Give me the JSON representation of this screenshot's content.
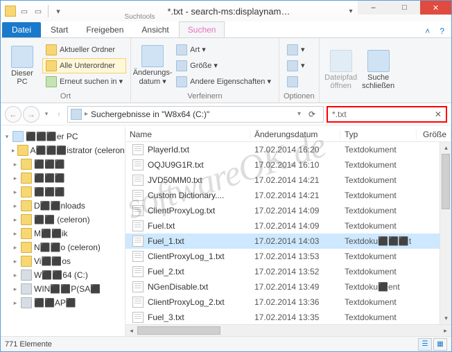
{
  "titlebar": {
    "search_tools_sup": "Suchtools",
    "search_tools_main": "Suchen",
    "title": "*.txt - search-ms:displaynam…"
  },
  "win": {
    "min": "–",
    "max": "□",
    "close": "✕",
    "dropdown": "▾"
  },
  "tabs": {
    "file": "Datei",
    "start": "Start",
    "share": "Freigeben",
    "view": "Ansicht",
    "search": "Suchen",
    "collapse": "˄",
    "help": "?"
  },
  "ribbon": {
    "this_pc": "Dieser PC",
    "current_folder": "Aktueller Ordner",
    "all_subfolders": "Alle Unterordner",
    "search_again": "Erneut suchen in ▾",
    "group_location": "Ort",
    "date_modified": "Änderungs- datum ▾",
    "kind": "Art ▾",
    "size": "Größe ▾",
    "other_props": "Andere Eigenschaften ▾",
    "group_refine": "Verfeinern",
    "options_dd": "▾",
    "group_options": "Optionen",
    "open_location": "Dateipfad öffnen",
    "close_search": "Suche schließen"
  },
  "nav": {
    "back": "←",
    "fwd": "→",
    "hist": "▾",
    "up": "↑",
    "addr_text": "Suchergebnisse in \"W8x64 (C:)\"",
    "addr_dd": "▾",
    "refresh": "⟳",
    "search_value": "*.txt",
    "clear": "✕"
  },
  "tree": [
    {
      "label": "⬛⬛⬛er PC",
      "icon": "pc",
      "indent": 0,
      "chev": "▾"
    },
    {
      "label": "A⬛⬛⬛istrator (celeron",
      "icon": "folder",
      "indent": 1,
      "chev": "▸"
    },
    {
      "label": "⬛⬛⬛",
      "icon": "folder",
      "indent": 1,
      "chev": "▸"
    },
    {
      "label": "⬛⬛⬛",
      "icon": "folder",
      "indent": 1,
      "chev": "▸"
    },
    {
      "label": "⬛⬛⬛",
      "icon": "folder",
      "indent": 1,
      "chev": "▸"
    },
    {
      "label": "D⬛⬛nloads",
      "icon": "folder",
      "indent": 1,
      "chev": "▸"
    },
    {
      "label": "⬛⬛ (celeron)",
      "icon": "folder",
      "indent": 1,
      "chev": "▸"
    },
    {
      "label": "M⬛⬛ik",
      "icon": "folder",
      "indent": 1,
      "chev": "▸"
    },
    {
      "label": "N⬛⬛o (celeron)",
      "icon": "folder",
      "indent": 1,
      "chev": "▸"
    },
    {
      "label": "Vi⬛⬛os",
      "icon": "folder",
      "indent": 1,
      "chev": "▸"
    },
    {
      "label": "W⬛⬛64 (C:)",
      "icon": "drive",
      "indent": 1,
      "chev": "▸"
    },
    {
      "label": "WIN⬛⬛P(SA⬛",
      "icon": "drive",
      "indent": 1,
      "chev": "▸"
    },
    {
      "label": "⬛⬛AP⬛",
      "icon": "drive",
      "indent": 1,
      "chev": "▸"
    }
  ],
  "columns": {
    "name": "Name",
    "date": "Änderungsdatum",
    "type": "Typ",
    "size": "Größe"
  },
  "files": [
    {
      "name": "PlayerId.txt",
      "date": "17.02.2014 16:20",
      "type": "Textdokument",
      "selected": false
    },
    {
      "name": "OQJU9G1R.txt",
      "date": "17.02.2014 16:10",
      "type": "Textdokument",
      "selected": false
    },
    {
      "name": "JVD50MM0.txt",
      "date": "17.02.2014 14:21",
      "type": "Textdokument",
      "selected": false
    },
    {
      "name": "Custom Dictionary....",
      "date": "17.02.2014 14:21",
      "type": "Textdokument",
      "selected": false
    },
    {
      "name": "ClientProxyLog.txt",
      "date": "17.02.2014 14:09",
      "type": "Textdokument",
      "selected": false
    },
    {
      "name": "Fuel.txt",
      "date": "17.02.2014 14:09",
      "type": "Textdokument",
      "selected": false
    },
    {
      "name": "Fuel_1.txt",
      "date": "17.02.2014 14:03",
      "type": "Textdoku⬛⬛⬛t",
      "selected": true
    },
    {
      "name": "ClientProxyLog_1.txt",
      "date": "17.02.2014 13:53",
      "type": "Textdokument",
      "selected": false
    },
    {
      "name": "Fuel_2.txt",
      "date": "17.02.2014 13:52",
      "type": "Textdokument",
      "selected": false
    },
    {
      "name": "NGenDisable.txt",
      "date": "17.02.2014 13:49",
      "type": "Textdoku⬛ent",
      "selected": false
    },
    {
      "name": "ClientProxyLog_2.txt",
      "date": "17.02.2014 13:36",
      "type": "Textdokument",
      "selected": false
    },
    {
      "name": "Fuel_3.txt",
      "date": "17.02.2014 13:35",
      "type": "Textdokument",
      "selected": false
    }
  ],
  "status": {
    "count": "771 Elemente"
  },
  "watermark": "softwareOK.de"
}
